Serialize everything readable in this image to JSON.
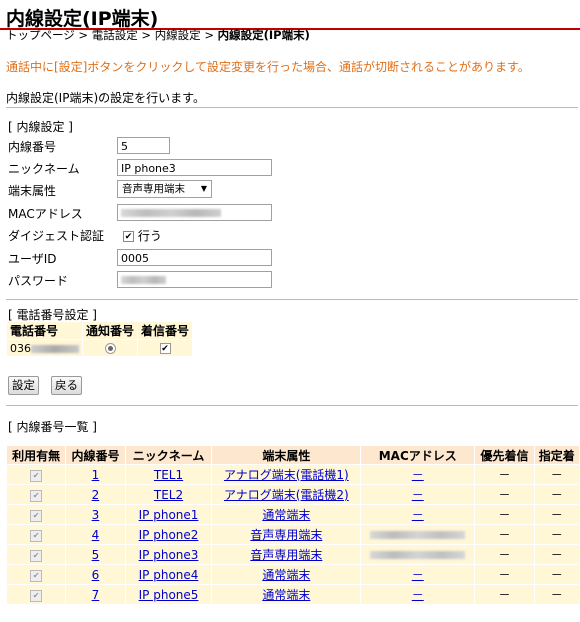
{
  "page": {
    "title": "内線設定(IP端末)",
    "breadcrumb": [
      "トップページ",
      "電話設定",
      "内線設定"
    ],
    "breadcrumb_current": "内線設定(IP端末)",
    "breadcrumb_sep": " > ",
    "warning": "通話中に[設定]ボタンをクリックして設定変更を行った場合、通話が切断されることがあります。",
    "description": "内線設定(IP端末)の設定を行います。"
  },
  "extension_settings": {
    "section_title": "[ 内線設定 ]",
    "number_label": "内線番号",
    "number_value": "5",
    "nickname_label": "ニックネーム",
    "nickname_value": "IP phone3",
    "terminal_type_label": "端末属性",
    "terminal_type_value": "音声専用端末",
    "mac_label": "MACアドレス",
    "digest_label": "ダイジェスト認証",
    "digest_check_label": "行う",
    "userid_label": "ユーザID",
    "userid_value": "0005",
    "password_label": "パスワード"
  },
  "phone_number_settings": {
    "section_title": "[ 電話番号設定 ]",
    "headers": [
      "電話番号",
      "通知番号",
      "着信番号"
    ],
    "number_prefix": "036"
  },
  "buttons": {
    "set": "設定",
    "back": "戻る"
  },
  "extension_list": {
    "section_title": "[ 内線番号一覧 ]",
    "headers": [
      "利用有無",
      "内線番号",
      "ニックネーム",
      "端末属性",
      "MACアドレス",
      "優先着信",
      "指定着"
    ],
    "rows": [
      {
        "no": "1",
        "nickname": "TEL1",
        "type": "アナログ端末(電話機1)",
        "mac": "－",
        "priority": "－",
        "designated": "－"
      },
      {
        "no": "2",
        "nickname": "TEL2",
        "type": "アナログ端末(電話機2)",
        "mac": "－",
        "priority": "－",
        "designated": "－"
      },
      {
        "no": "3",
        "nickname": "IP phone1",
        "type": "通常端末",
        "mac": "－",
        "priority": "－",
        "designated": "－"
      },
      {
        "no": "4",
        "nickname": "IP phone2",
        "type": "音声専用端末",
        "mac": "",
        "priority": "－",
        "designated": "－"
      },
      {
        "no": "5",
        "nickname": "IP phone3",
        "type": "音声専用端末",
        "mac": "",
        "priority": "－",
        "designated": "－"
      },
      {
        "no": "6",
        "nickname": "IP phone4",
        "type": "通常端末",
        "mac": "－",
        "priority": "－",
        "designated": "－"
      },
      {
        "no": "7",
        "nickname": "IP phone5",
        "type": "通常端末",
        "mac": "－",
        "priority": "－",
        "designated": "－"
      }
    ]
  },
  "colors": {
    "title_rule": "#c00000",
    "warning": "#e0701a",
    "row_bg": "#fff7d6",
    "header_bg": "#fde8cf",
    "link": "#0000cc"
  }
}
